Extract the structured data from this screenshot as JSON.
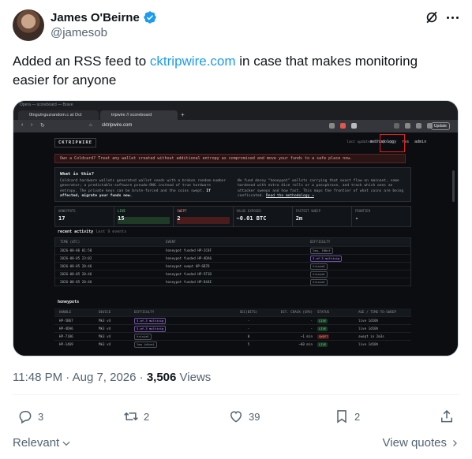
{
  "author": {
    "name": "James O'Beirne",
    "handle": "@jamesob"
  },
  "tweet": {
    "text_before": "Added an RSS feed to ",
    "link": "cktripwire.com",
    "text_after": " in case that makes monitoring easier for anyone"
  },
  "browser": {
    "window_title": "Opera — scoreboard — Brave",
    "tab1": "0tngu/nguzrandom.c at Oct",
    "tab2": "tripwire // scoreboard",
    "tab_plus": "+",
    "url": "cktripwire.com",
    "update_label": "Update"
  },
  "site": {
    "logo": "CKTRIPWIRE",
    "last_updated": "last updated 1 day ago",
    "nav": [
      "methodology",
      "rss",
      "admin"
    ],
    "warning": "Own a Coldcard? Treat any wallet created without additional entropy as compromised and move your funds to a safe place now.",
    "what_title": "What is this?",
    "what_col1": "Coldcard hardware wallets generated wallet seeds with a broken random-number generator; a predictable-software pseudo-RNG instead of true hardware entropy. The private keys can be brute-forced and the coins swept.",
    "what_col1_bold": "If affected, migrate your funds now.",
    "what_col2": "We fund decoy \"honeypot\" wallets carrying that exact flaw on mainnet, some hardened with extra dice rolls or a passphrase, and track which ones an attacker sweeps and how fast. This maps the frontier of what coins are being confiscated.",
    "what_col2_link": "Read the methodology →",
    "stats": [
      {
        "label": "HONEYPOTS",
        "value": "17"
      },
      {
        "label": "LIVE",
        "value": "15"
      },
      {
        "label": "SWEPT",
        "value": "2"
      },
      {
        "label": "VALUE EXPOSED",
        "value": "~0.01 BTC"
      },
      {
        "label": "FASTEST SWEEP",
        "value": "2m"
      },
      {
        "label": "FRONTIER",
        "value": "-"
      }
    ],
    "activity_title": "recent activity",
    "activity_sub": "last 9 events",
    "activity_headers": [
      "TIME (UTC)",
      "EVENT",
      "DIFFICULTY"
    ],
    "activity_rows": [
      {
        "time": "2026-08-06 01:58",
        "event": "honeypot funded HP-2C8F",
        "diff": "low, 10bit"
      },
      {
        "time": "2026-08-05 23:02",
        "event": "honeypot funded HP-4DA6",
        "diff": "3-of-3 multisig"
      },
      {
        "time": "2026-08-05 20:46",
        "event": "honeypot swept HP-6B7D",
        "diff": "trivial"
      },
      {
        "time": "2026-08-05 20:46",
        "event": "honeypot funded HP-5F1D",
        "diff": "trivial"
      },
      {
        "time": "2026-08-05 20:46",
        "event": "honeypot funded HP-D44E",
        "diff": "trivial"
      }
    ],
    "honeypots_title": "honeypots",
    "hp_headers": [
      "HANDLE",
      "DEVICE",
      "DIFFICULTY",
      "SEC(BITS)",
      "EST. CRACK (GPU)",
      "STATUS",
      "AGE / TIME-TO-SWEEP"
    ],
    "hp_rows": [
      {
        "handle": "HP-5B67",
        "device": "Mk3 v4",
        "diff": "3-of-3 multisig",
        "sec": "-",
        "est": "-",
        "status": "LIVE",
        "age": "live 1d10h",
        "swept": false
      },
      {
        "handle": "HP-4DA6",
        "device": "Mk3 v4",
        "diff": "3-of-3 multisig",
        "sec": "-",
        "est": "-",
        "status": "LIVE",
        "age": "live 1d10h",
        "swept": false
      },
      {
        "handle": "HP-7186",
        "device": "Mk3 v4",
        "diff": "trivial",
        "sec": "0",
        "est": "~1 min",
        "status": "SWEPT",
        "age": "swept in 2m3s",
        "swept": true
      },
      {
        "handle": "HP-1469",
        "device": "Mk3 v4",
        "diff": "low (dice)",
        "sec": "5",
        "est": "~60 min",
        "status": "LIVE",
        "age": "live 1d10h",
        "swept": false
      }
    ]
  },
  "meta": {
    "time": "11:48 PM · Aug 7, 2026 · ",
    "views_count": "3,506",
    "views_label": " Views"
  },
  "actions": {
    "replies": "3",
    "reposts": "2",
    "likes": "39",
    "bookmarks": "2"
  },
  "footer": {
    "relevant": "Relevant",
    "view_quotes": "View quotes"
  },
  "colors": {
    "accent": "#1d9bf0",
    "verified": "#1d9bf0",
    "highlight": "#e0211f"
  },
  "icons": [
    "verified-icon",
    "grok-icon",
    "more-icon",
    "reply-icon",
    "repost-icon",
    "like-icon",
    "bookmark-icon",
    "share-icon",
    "chevron-down-icon",
    "chevron-right-icon"
  ]
}
